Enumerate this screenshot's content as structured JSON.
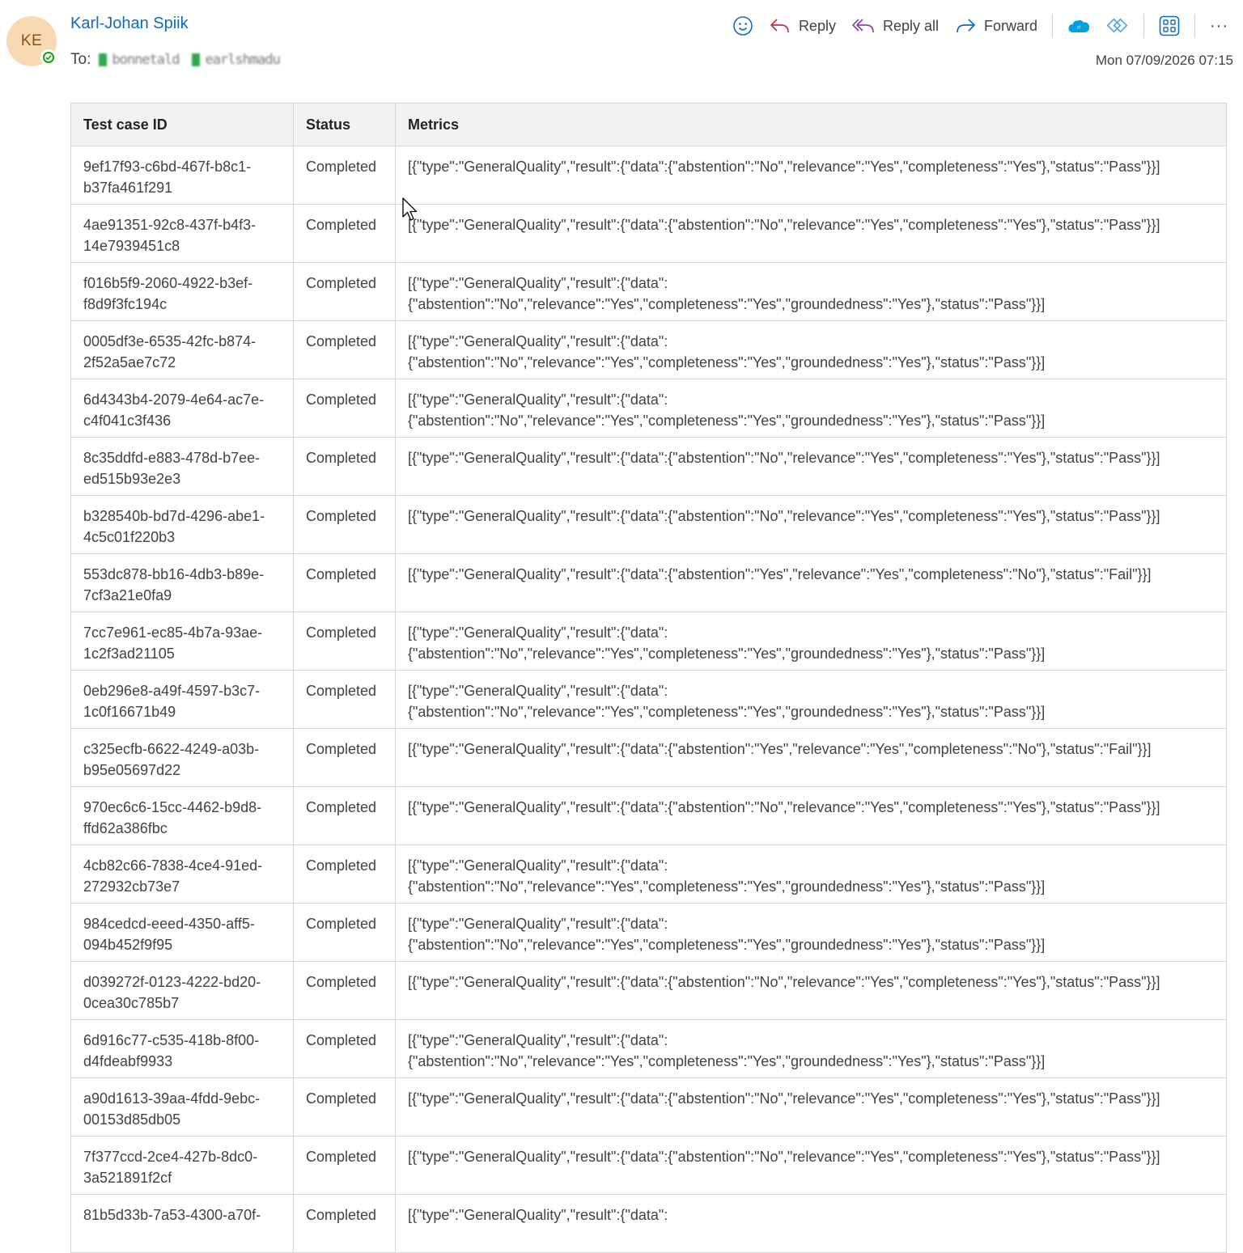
{
  "message": {
    "avatar_initials": "KE",
    "sender_name": "Karl-Johan Spiik",
    "to_label": "To:",
    "recipients": [
      "bonnetald",
      "earlshmadu"
    ],
    "date": "Mon 07/09/2026 07:15"
  },
  "toolbar": {
    "reply": "Reply",
    "reply_all": "Reply all",
    "forward": "Forward",
    "more": "···"
  },
  "table": {
    "headers": [
      "Test case ID",
      "Status",
      "Metrics"
    ],
    "rows": [
      {
        "id": "9ef17f93-c6bd-467f-b8c1-b37fa461f291",
        "status": "Completed",
        "metrics": "[{\"type\":\"GeneralQuality\",\"result\":{\"data\":{\"abstention\":\"No\",\"relevance\":\"Yes\",\"completeness\":\"Yes\"},\"status\":\"Pass\"}}]"
      },
      {
        "id": "4ae91351-92c8-437f-b4f3-14e7939451c8",
        "status": "Completed",
        "metrics": "[{\"type\":\"GeneralQuality\",\"result\":{\"data\":{\"abstention\":\"No\",\"relevance\":\"Yes\",\"completeness\":\"Yes\"},\"status\":\"Pass\"}}]"
      },
      {
        "id": "f016b5f9-2060-4922-b3ef-f8d9f3fc194c",
        "status": "Completed",
        "metrics": "[{\"type\":\"GeneralQuality\",\"result\":{\"data\":\n{\"abstention\":\"No\",\"relevance\":\"Yes\",\"completeness\":\"Yes\",\"groundedness\":\"Yes\"},\"status\":\"Pass\"}}]"
      },
      {
        "id": "0005df3e-6535-42fc-b874-2f52a5ae7c72",
        "status": "Completed",
        "metrics": "[{\"type\":\"GeneralQuality\",\"result\":{\"data\":\n{\"abstention\":\"No\",\"relevance\":\"Yes\",\"completeness\":\"Yes\",\"groundedness\":\"Yes\"},\"status\":\"Pass\"}}]"
      },
      {
        "id": "6d4343b4-2079-4e64-ac7e-c4f041c3f436",
        "status": "Completed",
        "metrics": "[{\"type\":\"GeneralQuality\",\"result\":{\"data\":\n{\"abstention\":\"No\",\"relevance\":\"Yes\",\"completeness\":\"Yes\",\"groundedness\":\"Yes\"},\"status\":\"Pass\"}}]"
      },
      {
        "id": "8c35ddfd-e883-478d-b7ee-ed515b93e2e3",
        "status": "Completed",
        "metrics": "[{\"type\":\"GeneralQuality\",\"result\":{\"data\":{\"abstention\":\"No\",\"relevance\":\"Yes\",\"completeness\":\"Yes\"},\"status\":\"Pass\"}}]"
      },
      {
        "id": "b328540b-bd7d-4296-abe1-4c5c01f220b3",
        "status": "Completed",
        "metrics": "[{\"type\":\"GeneralQuality\",\"result\":{\"data\":{\"abstention\":\"No\",\"relevance\":\"Yes\",\"completeness\":\"Yes\"},\"status\":\"Pass\"}}]"
      },
      {
        "id": "553dc878-bb16-4db3-b89e-7cf3a21e0fa9",
        "status": "Completed",
        "metrics": "[{\"type\":\"GeneralQuality\",\"result\":{\"data\":{\"abstention\":\"Yes\",\"relevance\":\"Yes\",\"completeness\":\"No\"},\"status\":\"Fail\"}}]"
      },
      {
        "id": "7cc7e961-ec85-4b7a-93ae-1c2f3ad21105",
        "status": "Completed",
        "metrics": "[{\"type\":\"GeneralQuality\",\"result\":{\"data\":\n{\"abstention\":\"No\",\"relevance\":\"Yes\",\"completeness\":\"Yes\",\"groundedness\":\"Yes\"},\"status\":\"Pass\"}}]"
      },
      {
        "id": "0eb296e8-a49f-4597-b3c7-1c0f16671b49",
        "status": "Completed",
        "metrics": "[{\"type\":\"GeneralQuality\",\"result\":{\"data\":\n{\"abstention\":\"No\",\"relevance\":\"Yes\",\"completeness\":\"Yes\",\"groundedness\":\"Yes\"},\"status\":\"Pass\"}}]"
      },
      {
        "id": "c325ecfb-6622-4249-a03b-b95e05697d22",
        "status": "Completed",
        "metrics": "[{\"type\":\"GeneralQuality\",\"result\":{\"data\":{\"abstention\":\"Yes\",\"relevance\":\"Yes\",\"completeness\":\"No\"},\"status\":\"Fail\"}}]"
      },
      {
        "id": "970ec6c6-15cc-4462-b9d8-ffd62a386fbc",
        "status": "Completed",
        "metrics": "[{\"type\":\"GeneralQuality\",\"result\":{\"data\":{\"abstention\":\"No\",\"relevance\":\"Yes\",\"completeness\":\"Yes\"},\"status\":\"Pass\"}}]"
      },
      {
        "id": "4cb82c66-7838-4ce4-91ed-272932cb73e7",
        "status": "Completed",
        "metrics": "[{\"type\":\"GeneralQuality\",\"result\":{\"data\":\n{\"abstention\":\"No\",\"relevance\":\"Yes\",\"completeness\":\"Yes\",\"groundedness\":\"Yes\"},\"status\":\"Pass\"}}]"
      },
      {
        "id": "984cedcd-eeed-4350-aff5-094b452f9f95",
        "status": "Completed",
        "metrics": "[{\"type\":\"GeneralQuality\",\"result\":{\"data\":\n{\"abstention\":\"No\",\"relevance\":\"Yes\",\"completeness\":\"Yes\",\"groundedness\":\"Yes\"},\"status\":\"Pass\"}}]"
      },
      {
        "id": "d039272f-0123-4222-bd20-0cea30c785b7",
        "status": "Completed",
        "metrics": "[{\"type\":\"GeneralQuality\",\"result\":{\"data\":{\"abstention\":\"No\",\"relevance\":\"Yes\",\"completeness\":\"Yes\"},\"status\":\"Pass\"}}]"
      },
      {
        "id": "6d916c77-c535-418b-8f00-d4fdeabf9933",
        "status": "Completed",
        "metrics": "[{\"type\":\"GeneralQuality\",\"result\":{\"data\":\n{\"abstention\":\"No\",\"relevance\":\"Yes\",\"completeness\":\"Yes\",\"groundedness\":\"Yes\"},\"status\":\"Pass\"}}]"
      },
      {
        "id": "a90d1613-39aa-4fdd-9ebc-00153d85db05",
        "status": "Completed",
        "metrics": "[{\"type\":\"GeneralQuality\",\"result\":{\"data\":{\"abstention\":\"No\",\"relevance\":\"Yes\",\"completeness\":\"Yes\"},\"status\":\"Pass\"}}]"
      },
      {
        "id": "7f377ccd-2ce4-427b-8dc0-3a521891f2cf",
        "status": "Completed",
        "metrics": "[{\"type\":\"GeneralQuality\",\"result\":{\"data\":{\"abstention\":\"No\",\"relevance\":\"Yes\",\"completeness\":\"Yes\"},\"status\":\"Pass\"}}]"
      },
      {
        "id": "81b5d33b-7a53-4300-a70f-",
        "status": "Completed",
        "metrics": "[{\"type\":\"GeneralQuality\",\"result\":{\"data\":"
      }
    ]
  },
  "colors": {
    "sender": "#0f6cbd",
    "avatar_bg": "#f8d9b2",
    "presence": "#13a10e",
    "table_header_bg": "#f2f2f2",
    "border": "#d6d6d6"
  }
}
